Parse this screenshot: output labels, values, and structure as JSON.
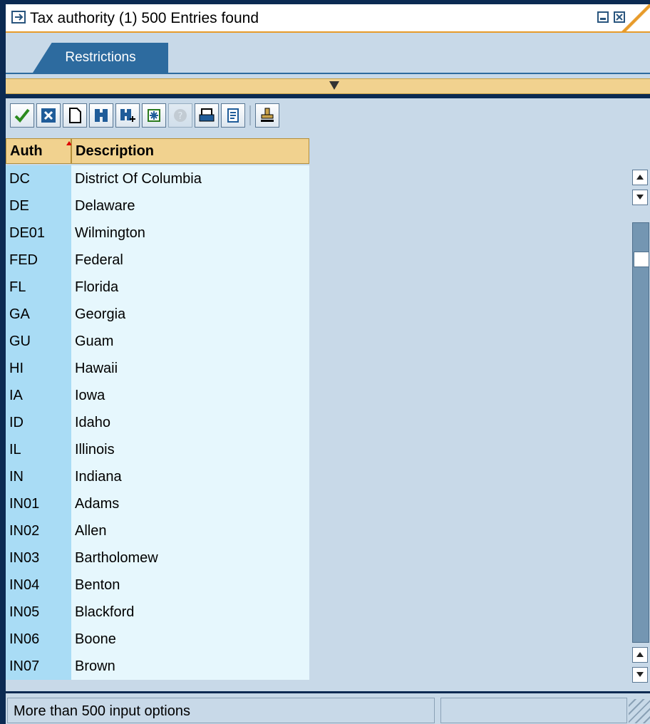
{
  "window": {
    "title": "Tax authority (1)  500 Entries found"
  },
  "tabs": [
    {
      "label": "Restrictions"
    }
  ],
  "toolbar": {
    "buttons": [
      {
        "icon": "checkmark-icon"
      },
      {
        "icon": "cancel-icon"
      },
      {
        "icon": "new-document-icon"
      },
      {
        "icon": "find-icon"
      },
      {
        "icon": "find-next-icon"
      },
      {
        "icon": "select-all-icon"
      },
      {
        "icon": "help-icon",
        "disabled": true
      },
      {
        "icon": "print-icon"
      },
      {
        "icon": "print-preview-icon"
      },
      {
        "icon": "stamp-icon"
      }
    ]
  },
  "table": {
    "columns": [
      "Auth",
      "Description"
    ],
    "rows": [
      [
        "DC",
        "District Of Columbia"
      ],
      [
        "DE",
        "Delaware"
      ],
      [
        "DE01",
        "Wilmington"
      ],
      [
        "FED",
        "Federal"
      ],
      [
        "FL",
        "Florida"
      ],
      [
        "GA",
        "Georgia"
      ],
      [
        "GU",
        "Guam"
      ],
      [
        "HI",
        "Hawaii"
      ],
      [
        "IA",
        "Iowa"
      ],
      [
        "ID",
        "Idaho"
      ],
      [
        "IL",
        "Illinois"
      ],
      [
        "IN",
        "Indiana"
      ],
      [
        "IN01",
        "Adams"
      ],
      [
        "IN02",
        "Allen"
      ],
      [
        "IN03",
        "Bartholomew"
      ],
      [
        "IN04",
        "Benton"
      ],
      [
        "IN05",
        "Blackford"
      ],
      [
        "IN06",
        "Boone"
      ],
      [
        "IN07",
        "Brown"
      ]
    ]
  },
  "status": {
    "message": "More than  500 input options"
  }
}
